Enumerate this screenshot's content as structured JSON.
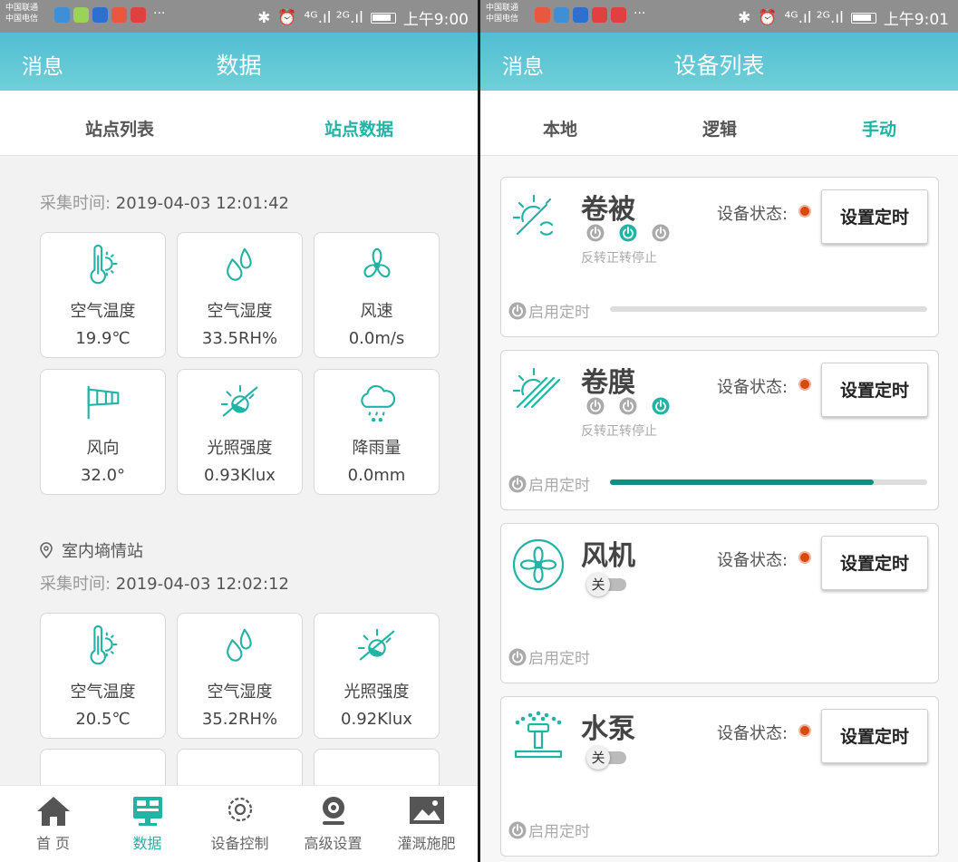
{
  "left": {
    "status": {
      "carrier1": "中国联通",
      "carrier2": "中国电信",
      "time": "上午9:00",
      "signal": "⁴ᴳ.ıl ²ᴳ.ıl"
    },
    "appbar": {
      "left": "消息",
      "title": "数据"
    },
    "tabs": [
      "站点列表",
      "站点数据"
    ],
    "active_tab": 1,
    "station1": {
      "time_label": "采集时间: ",
      "time": "2019-04-03 12:01:42",
      "tiles": [
        {
          "icon": "thermometer-sun-icon",
          "label": "空气温度",
          "value": "19.9℃"
        },
        {
          "icon": "droplets-icon",
          "label": "空气湿度",
          "value": "33.5RH%"
        },
        {
          "icon": "fan-icon",
          "label": "风速",
          "value": "0.0m/s"
        },
        {
          "icon": "windsock-icon",
          "label": "风向",
          "value": "32.0°"
        },
        {
          "icon": "light-sensor-icon",
          "label": "光照强度",
          "value": "0.93Klux"
        },
        {
          "icon": "rain-cloud-icon",
          "label": "降雨量",
          "value": "0.0mm"
        }
      ]
    },
    "station2": {
      "name": "室内墒情站",
      "time_label": "采集时间: ",
      "time": "2019-04-03 12:02:12",
      "tiles": [
        {
          "icon": "thermometer-sun-icon",
          "label": "空气温度",
          "value": "20.5℃"
        },
        {
          "icon": "droplets-icon",
          "label": "空气湿度",
          "value": "35.2RH%"
        },
        {
          "icon": "light-sensor-icon",
          "label": "光照强度",
          "value": "0.92Klux"
        }
      ]
    },
    "nav": [
      {
        "icon": "home-icon",
        "label": "首 页"
      },
      {
        "icon": "monitor-icon",
        "label": "数据"
      },
      {
        "icon": "gear-icon",
        "label": "设备控制"
      },
      {
        "icon": "webcam-icon",
        "label": "高级设置"
      },
      {
        "icon": "image-icon",
        "label": "灌溉施肥"
      }
    ],
    "active_nav": 1
  },
  "right": {
    "status": {
      "carrier1": "中国联通",
      "carrier2": "中国电信",
      "time": "上午9:01",
      "signal": "⁴ᴳ.ıl ²ᴳ.ıl"
    },
    "appbar": {
      "left": "消息",
      "title": "设备列表"
    },
    "tabs": [
      "本地",
      "逻辑",
      "手动"
    ],
    "active_tab": 2,
    "status_label": "设备状态:",
    "set_timer": "设置定时",
    "timer_label": "启用定时",
    "action_labels": "反转正转停止",
    "devices": [
      {
        "name": "卷被",
        "icon": "roller-blind-icon",
        "type": "motor",
        "active_action": 1,
        "timer_progress": 0
      },
      {
        "name": "卷膜",
        "icon": "roller-film-icon",
        "type": "motor",
        "active_action": 2,
        "timer_progress": 0.83
      },
      {
        "name": "风机",
        "icon": "fan-icon",
        "type": "switch",
        "switch_label": "关"
      },
      {
        "name": "水泵",
        "icon": "sprinkler-icon",
        "type": "switch",
        "switch_label": "关"
      }
    ]
  },
  "colors": {
    "accent": "#22b3a5",
    "appbar": "#5ec5d5",
    "led": "#d84a0b",
    "progress": "#0f8f82"
  }
}
